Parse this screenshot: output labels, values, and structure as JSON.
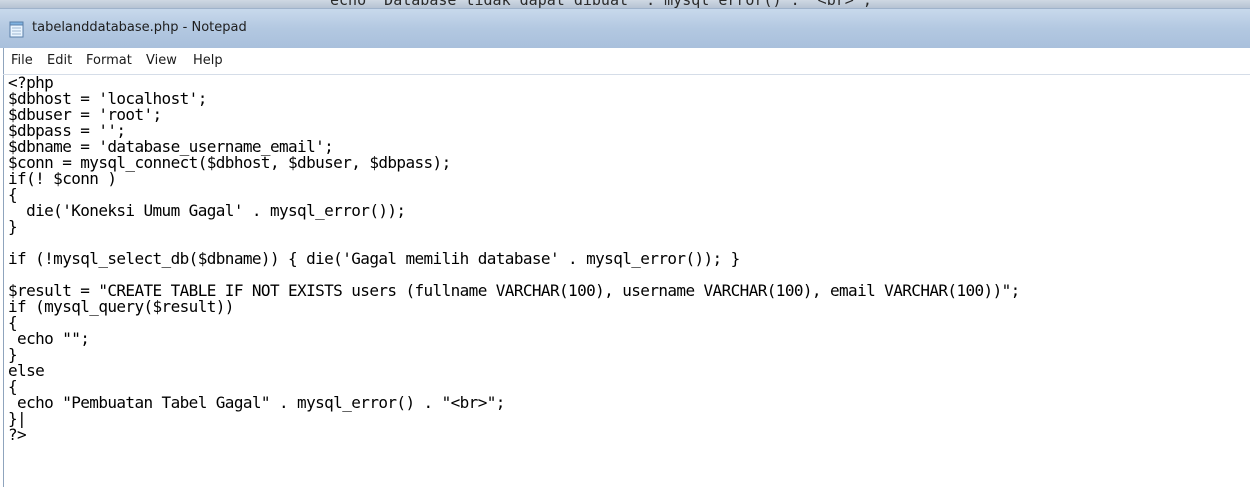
{
  "background_window": {
    "partial_text": "echo \"Database tidak dapat dibuat\" . mysql_error() . \"<br>\";"
  },
  "window": {
    "title": "tabelanddatabase.php - Notepad",
    "icon": "notepad-icon"
  },
  "menu": {
    "items": [
      {
        "label": "File"
      },
      {
        "label": "Edit"
      },
      {
        "label": "Format"
      },
      {
        "label": "View"
      },
      {
        "label": "Help"
      }
    ]
  },
  "editor": {
    "lines": [
      "<?php",
      "$dbhost = 'localhost';",
      "$dbuser = 'root';",
      "$dbpass = '';",
      "$dbname = 'database_username_email';",
      "$conn = mysql_connect($dbhost, $dbuser, $dbpass);",
      "if(! $conn )",
      "{",
      "  die('Koneksi Umum Gagal' . mysql_error());",
      "}",
      "",
      "if (!mysql_select_db($dbname)) { die('Gagal memilih database' . mysql_error()); }",
      "",
      "$result = \"CREATE TABLE IF NOT EXISTS users (fullname VARCHAR(100), username VARCHAR(100), email VARCHAR(100))\";",
      "if (mysql_query($result))",
      "{",
      " echo \"\";",
      "}",
      "else",
      "{",
      " echo \"Pembuatan Tabel Gagal\" . mysql_error() . \"<br>\";",
      "}|",
      "?>"
    ]
  }
}
